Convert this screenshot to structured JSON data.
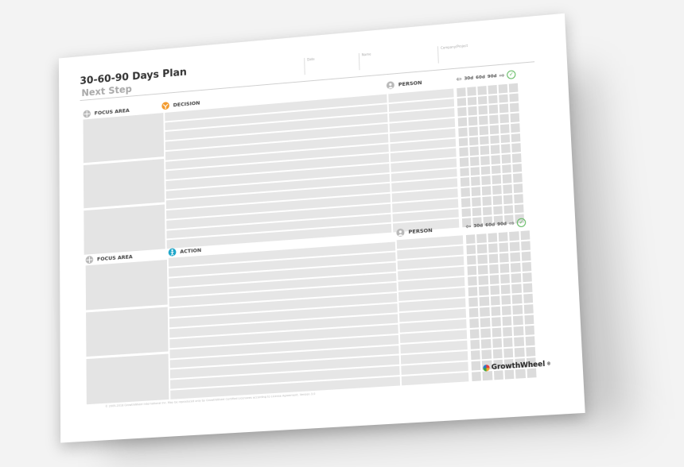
{
  "document": {
    "title": "30-60-90 Days Plan",
    "subtitle": "Next Step",
    "fields": [
      "Date",
      "Name",
      "Company/Project"
    ]
  },
  "section1": {
    "focus_area": "FOCUS AREA",
    "column_label": "DECISION",
    "person": "PERSON",
    "days": [
      "30d",
      "60d",
      "90d"
    ]
  },
  "section2": {
    "focus_area": "FOCUS AREA",
    "column_label": "ACTION",
    "person": "PERSON",
    "days": [
      "30d",
      "60d",
      "90d"
    ]
  },
  "brand": {
    "name": "GrowthWheel",
    "mark": "®",
    "footer": "© 2005-2018 GrowthWheel International Inc. May be reproduced only by GrowthWheel Certified Licensees according to License Agreement. Version 3.0"
  },
  "colors": {
    "decision_icon": "#f39a2c",
    "action_icon": "#1aa5c9",
    "check": "#5cb85c"
  },
  "icons": [
    "crosshair-icon",
    "decision-icon",
    "action-icon",
    "person-icon",
    "arrow-left-icon",
    "arrow-right-icon",
    "check-icon",
    "growthwheel-logo-icon"
  ]
}
